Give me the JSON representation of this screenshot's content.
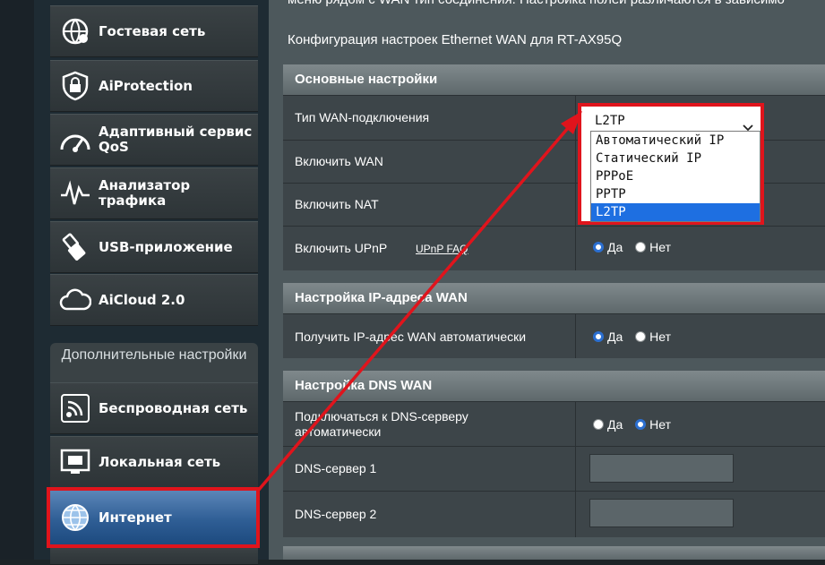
{
  "sidebar": {
    "items": [
      {
        "label": "Гостевая сеть",
        "icon": "guest-network-icon"
      },
      {
        "label": "AiProtection",
        "icon": "shield-lock-icon"
      },
      {
        "label": "Адаптивный сервис QoS",
        "icon": "speedometer-icon"
      },
      {
        "label": "Анализатор трафика",
        "icon": "traffic-analyzer-icon"
      },
      {
        "label": "USB-приложение",
        "icon": "usb-icon"
      },
      {
        "label": "AiCloud 2.0",
        "icon": "cloud-icon"
      }
    ],
    "advanced_header": "Дополнительные настройки",
    "advanced_items": [
      {
        "label": "Беспроводная сеть",
        "icon": "wireless-icon"
      },
      {
        "label": "Локальная сеть",
        "icon": "lan-icon"
      },
      {
        "label": "Интернет",
        "icon": "globe-icon",
        "active": true
      }
    ]
  },
  "main": {
    "intro_top": "меню рядом с WAN тип соединения. Настройка полей различаются в зависимо",
    "config_title": "Конфигурация настроек Ethernet WAN для RT-AX95Q",
    "basic": {
      "header": "Основные настройки",
      "wan_type_label": "Тип WAN-подключения",
      "enable_wan_label": "Включить WAN",
      "enable_nat_label": "Включить NAT",
      "enable_upnp_label": "Включить UPnP",
      "upnp_faq": "UPnP  FAQ",
      "upnp_yes": "Да",
      "upnp_no": "Нет"
    },
    "wan_ip": {
      "header": "Настройка IP-адреса WAN",
      "auto_label": "Получить IP-адрес WAN автоматически",
      "yes": "Да",
      "no": "Нет"
    },
    "dns": {
      "header": "Настройка DNS WAN",
      "auto_label": "Подключаться к DNS-серверу автоматически",
      "yes": "Да",
      "no": "Нет",
      "dns1_label": "DNS-сервер 1",
      "dns2_label": "DNS-сервер 2"
    }
  },
  "dropdown": {
    "selected": "L2TP",
    "options": [
      "Автоматический IP",
      "Статический IP",
      "PPPoE",
      "PPTP",
      "L2TP"
    ]
  },
  "colors": {
    "highlight_red": "#e0141c",
    "active_blue": "#2f5e95",
    "option_selected": "#1e6fe1"
  }
}
